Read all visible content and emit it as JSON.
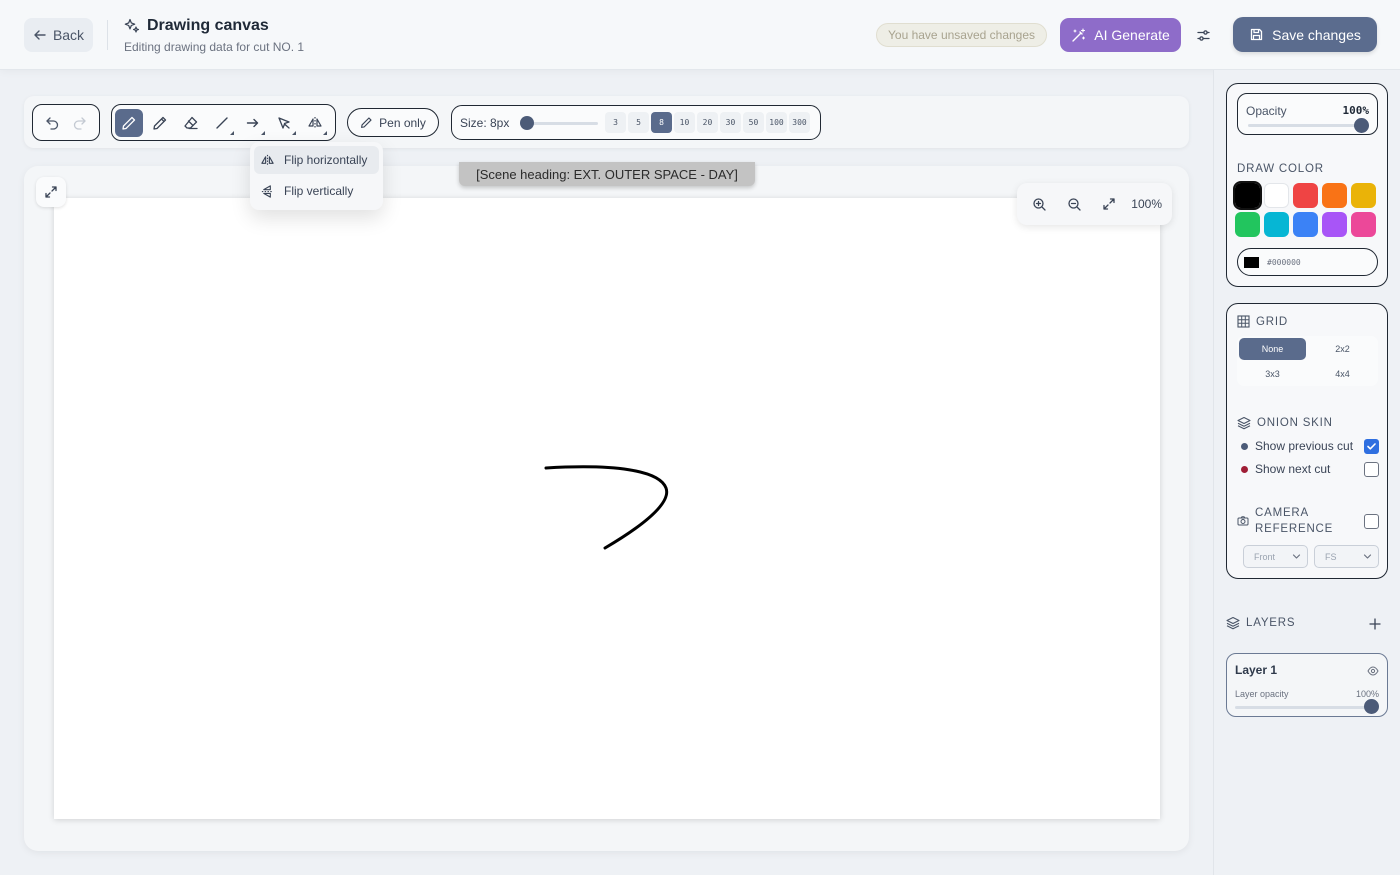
{
  "header": {
    "back_label": "Back",
    "title": "Drawing canvas",
    "subtitle": "Editing drawing data for cut NO. 1",
    "unsaved_badge": "You have unsaved changes",
    "ai_generate_label": "AI Generate",
    "save_label": "Save changes"
  },
  "toolbar": {
    "pen_only_label": "Pen only",
    "size_label": "Size: 8px",
    "size_value": 8,
    "size_presets": [
      "3",
      "5",
      "8",
      "10",
      "20",
      "30",
      "50",
      "100",
      "300"
    ],
    "active_preset": "8",
    "tools": [
      "pen-icon",
      "pencil-icon",
      "eraser-icon",
      "line-icon",
      "arrow-icon",
      "select-icon",
      "flip-icon"
    ],
    "active_tool": "pen-icon"
  },
  "flip_menu": {
    "items": [
      "Flip horizontally",
      "Flip vertically"
    ]
  },
  "canvas": {
    "scene_label": "[Scene heading: EXT. OUTER SPACE - DAY]",
    "zoom_label": "100%"
  },
  "sidebar": {
    "opacity_label": "Opacity",
    "opacity_value": "100%",
    "draw_color_heading": "DRAW COLOR",
    "swatches": [
      "#000000",
      "#ffffff",
      "#ef4444",
      "#f97316",
      "#eab308",
      "#22c55e",
      "#06b6d4",
      "#3b82f6",
      "#a855f7",
      "#ec4899"
    ],
    "selected_color": "#000000",
    "hex_value": "#000000",
    "grid_heading": "GRID",
    "grid_options": [
      "None",
      "2x2",
      "3x3",
      "4x4"
    ],
    "grid_active": "None",
    "onion_heading": "ONION SKIN",
    "show_previous_label": "Show previous cut",
    "show_previous_checked": true,
    "show_next_label": "Show next cut",
    "show_next_checked": false,
    "previous_dot_color": "#4c5b78",
    "next_dot_color": "#9f1d35",
    "camera_heading": "CAMERA REFERENCE",
    "camera_checked": false,
    "camera_view": "Front",
    "camera_shot": "FS",
    "layers_heading": "LAYERS",
    "layer_name": "Layer 1",
    "layer_opacity_label": "Layer opacity",
    "layer_opacity_value": "100%"
  },
  "colors": {
    "accent": "#5a6b8c",
    "ai_purple": "#8e6cc9",
    "checkbox_blue": "#2f6fe0"
  }
}
